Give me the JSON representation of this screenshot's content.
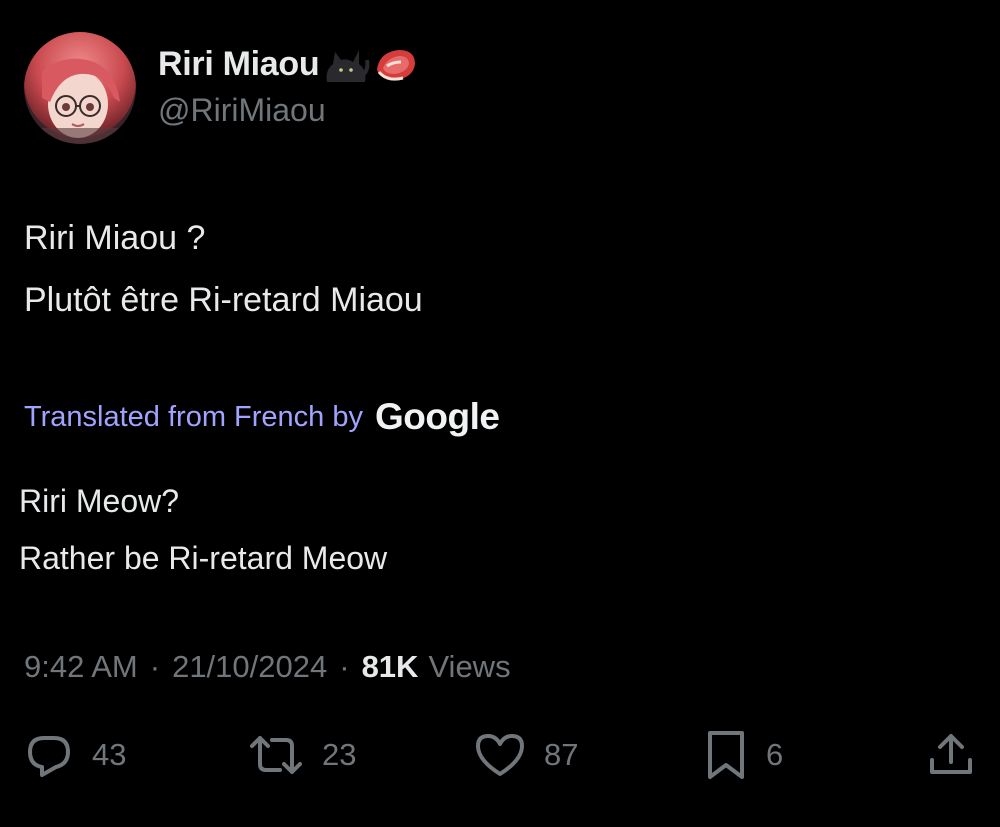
{
  "author": {
    "display_name": "Riri Miaou",
    "name_emojis": [
      "black-cat-emoji",
      "meat-on-bone-emoji"
    ],
    "handle": "@RiriMiaou",
    "avatar": "avatar-anime-girl-red-hair-glasses"
  },
  "tweet": {
    "lines": [
      "Riri Miaou ?",
      "Plutôt être Ri-retard Miaou"
    ]
  },
  "translation": {
    "label": "Translated from French by",
    "provider": "Google",
    "lines": [
      "Riri Meow?",
      "Rather be Ri-retard Meow"
    ]
  },
  "meta": {
    "time": "9:42 AM",
    "separator": "·",
    "date": "21/10/2024",
    "views_count": "81K",
    "views_label": "Views"
  },
  "actions": {
    "reply": {
      "icon": "reply-icon",
      "count": "43"
    },
    "retweet": {
      "icon": "retweet-icon",
      "count": "23"
    },
    "like": {
      "icon": "heart-icon",
      "count": "87"
    },
    "bookmark": {
      "icon": "bookmark-icon",
      "count": "6"
    },
    "share": {
      "icon": "share-icon"
    }
  },
  "colors": {
    "background": "#000000",
    "text_primary": "#e7e9ea",
    "text_secondary": "#71767b",
    "translated_label": "#a2a3ff"
  }
}
